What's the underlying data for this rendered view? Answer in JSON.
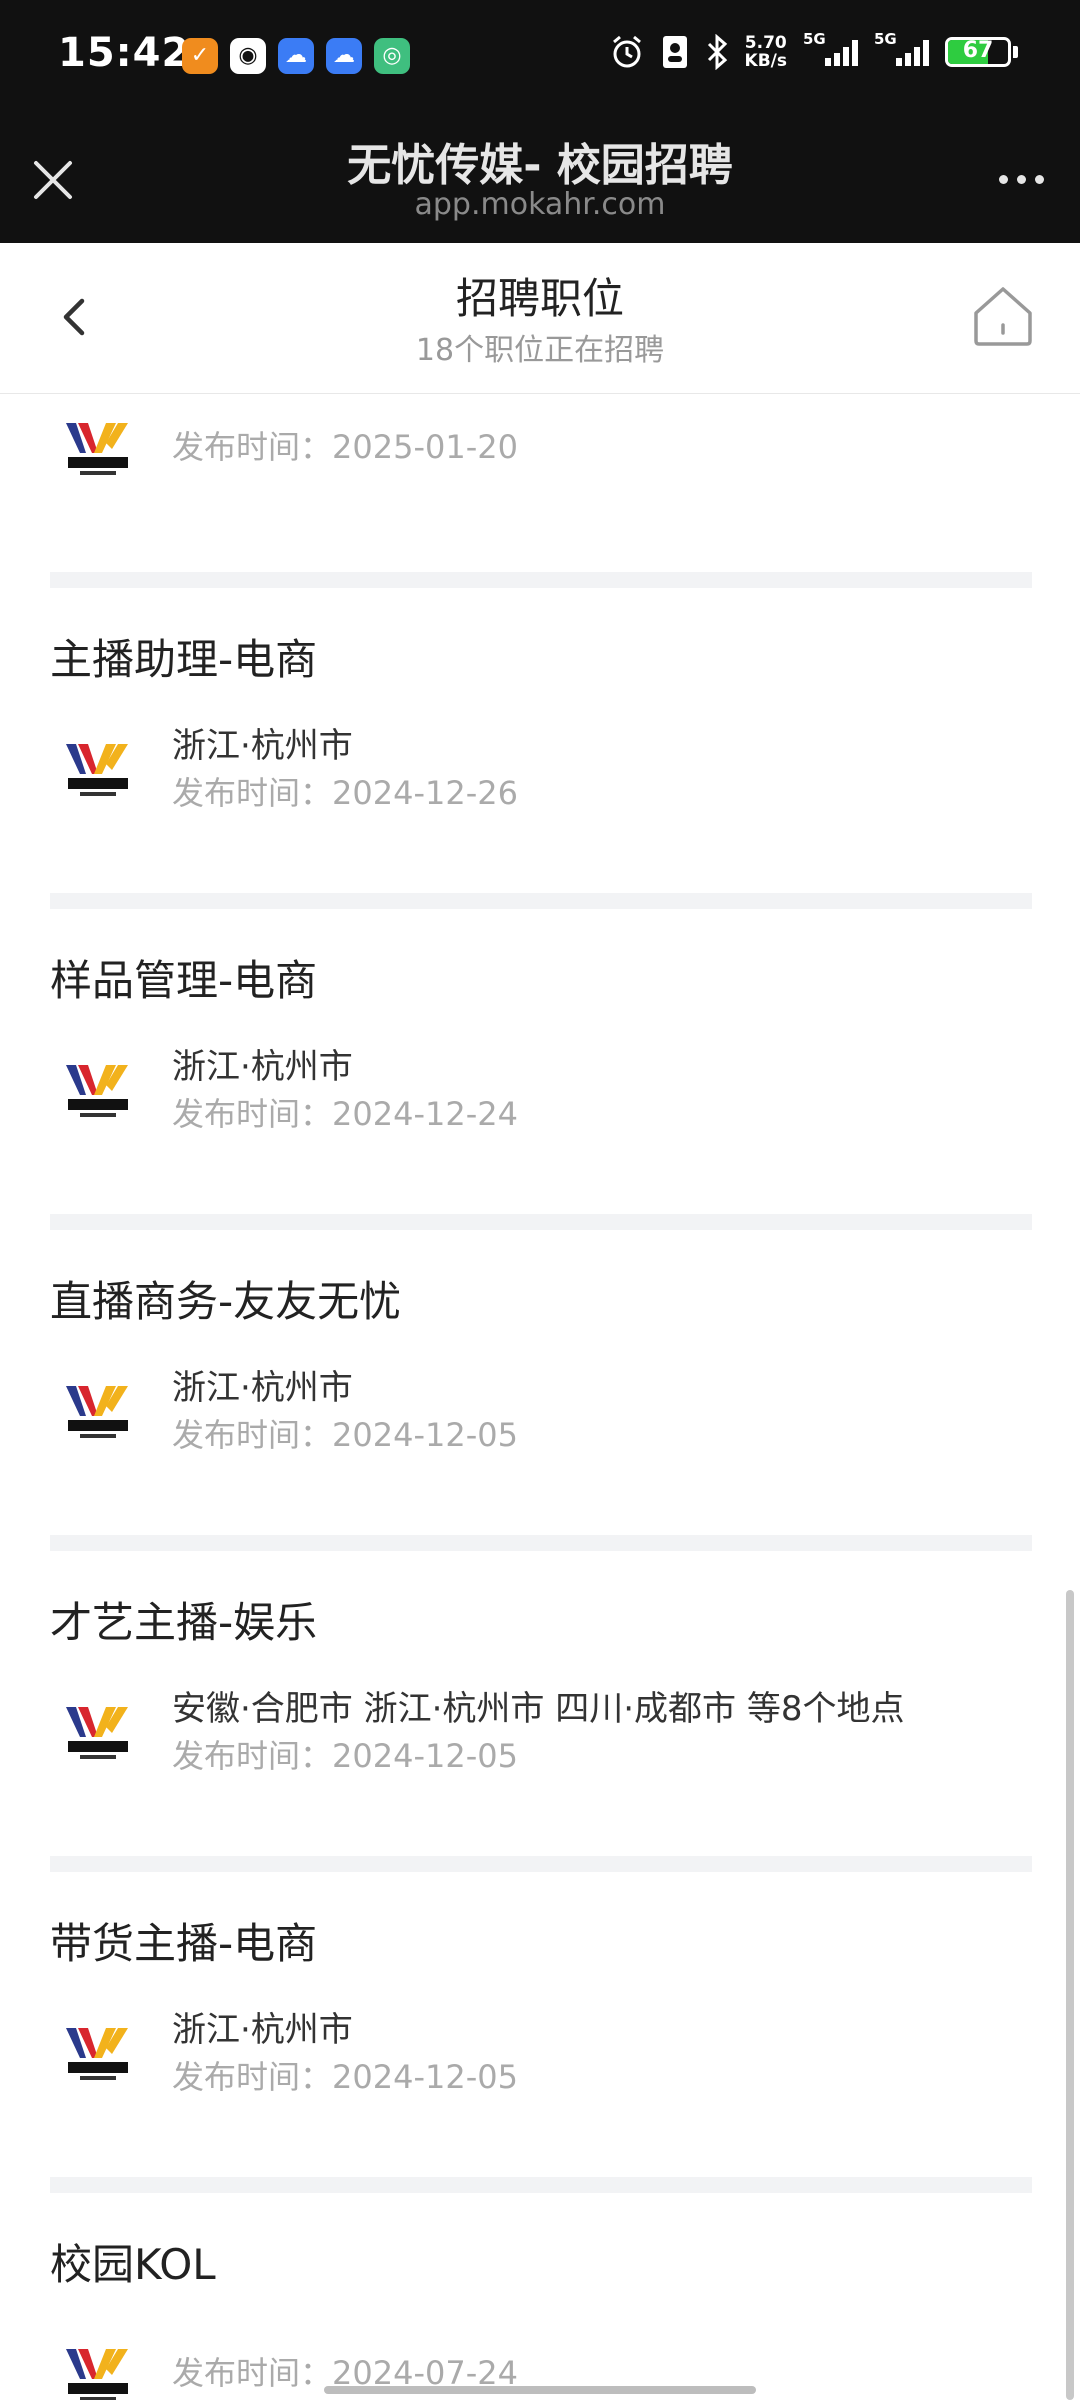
{
  "status_bar": {
    "time": "15:42",
    "net_speed_value": "5.70",
    "net_speed_unit": "KB/s",
    "sim1_gen": "5G",
    "sim2_gen": "5G",
    "battery": "67",
    "battery_level": 0.67,
    "app_icons": [
      "check-app-icon",
      "qq-icon",
      "weather-icon",
      "weather-icon",
      "hotspot-icon"
    ],
    "status_icons": [
      "alarm-icon",
      "contact-card-icon",
      "bluetooth-icon"
    ]
  },
  "webview": {
    "title": "无忧传媒- 校园招聘",
    "url": "app.mokahr.com"
  },
  "header": {
    "title": "招聘职位",
    "subtitle": "18个职位正在招聘"
  },
  "jobs": [
    {
      "title": "",
      "location": "",
      "date": "发布时间：2025-01-20"
    },
    {
      "title": "主播助理-电商",
      "location": "浙江·杭州市",
      "date": "发布时间：2024-12-26"
    },
    {
      "title": "样品管理-电商",
      "location": "浙江·杭州市",
      "date": "发布时间：2024-12-24"
    },
    {
      "title": "直播商务-友友无忧",
      "location": "浙江·杭州市",
      "date": "发布时间：2024-12-05"
    },
    {
      "title": "才艺主播-娱乐",
      "location": "安徽·合肥市  浙江·杭州市  四川·成都市  等8个地点",
      "date": "发布时间：2024-12-05"
    },
    {
      "title": "带货主播-电商",
      "location": "浙江·杭州市",
      "date": "发布时间：2024-12-05"
    },
    {
      "title": "校园KOL",
      "location": "",
      "date": "发布时间：2024-07-24"
    }
  ],
  "colors": {
    "logo_blue": "#2b3a8c",
    "logo_red": "#d8262e",
    "logo_yellow": "#f2b21c"
  }
}
